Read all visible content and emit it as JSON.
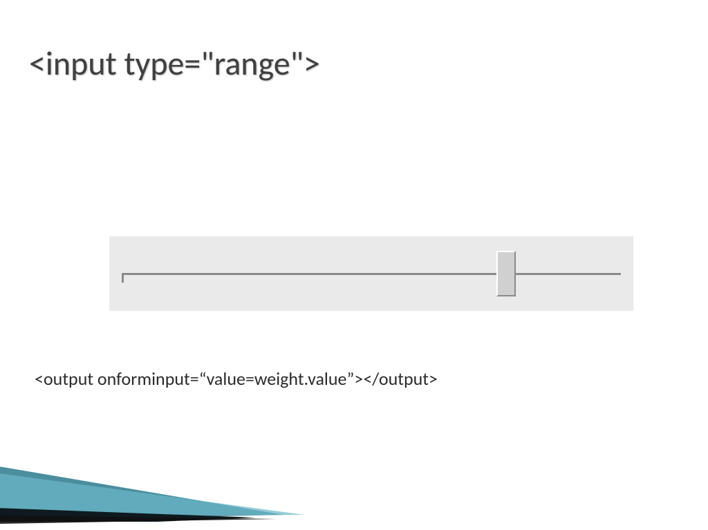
{
  "title": "<input type=\"range\">",
  "slider": {
    "value_percent": 77
  },
  "subtext": "<output onforminput=“value=weight.value”></output>"
}
